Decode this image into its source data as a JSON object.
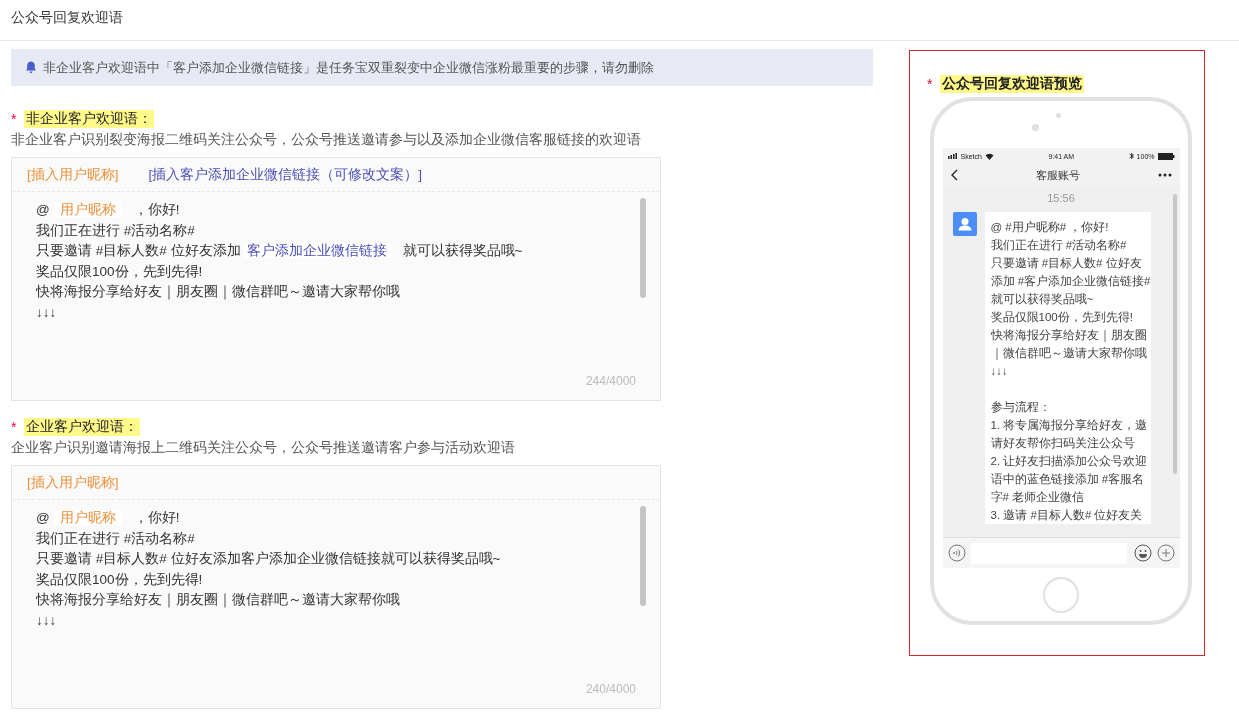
{
  "page_title": "公众号回复欢迎语",
  "notice": {
    "text": "非企业客户欢迎语中「客户添加企业微信链接」是任务宝双重裂变中企业微信涨粉最重要的步骤，请勿删除"
  },
  "sections": [
    {
      "required_mark": "*",
      "label": "非企业客户欢迎语：",
      "description": "非企业客户识别裂变海报二维码关注公众号，公众号推送邀请参与以及添加企业微信客服链接的欢迎语",
      "toolbar": [
        {
          "label": "[插入用户昵称]",
          "kind": "nickname"
        },
        {
          "label": "[插入客户添加企业微信链接（可修改文案）]",
          "kind": "link"
        }
      ],
      "lines": [
        [
          {
            "kind": "text",
            "text": "@"
          },
          {
            "kind": "nickname",
            "text": "用户昵称"
          },
          {
            "kind": "text",
            "text": "，你好!"
          }
        ],
        [
          {
            "kind": "text",
            "text": "我们正在进行 #活动名称#"
          }
        ],
        [
          {
            "kind": "text",
            "text": "只要邀请 #目标人数# 位好友添加"
          },
          {
            "kind": "link",
            "text": "客户添加企业微信链接"
          },
          {
            "kind": "text",
            "text": "就可以获得奖品哦~"
          }
        ],
        [
          {
            "kind": "text",
            "text": "奖品仅限100份，先到先得!"
          }
        ],
        [
          {
            "kind": "text",
            "text": "快将海报分享给好友｜朋友圈｜微信群吧～邀请大家帮你哦"
          }
        ],
        [
          {
            "kind": "text",
            "text": "↓↓↓"
          }
        ]
      ],
      "counter": "244/4000"
    },
    {
      "required_mark": "*",
      "label": "企业客户欢迎语：",
      "description": "企业客户识别邀请海报上二维码关注公众号，公众号推送邀请客户参与活动欢迎语",
      "toolbar": [
        {
          "label": "[插入用户昵称]",
          "kind": "nickname"
        }
      ],
      "lines": [
        [
          {
            "kind": "text",
            "text": "@"
          },
          {
            "kind": "nickname",
            "text": "用户昵称"
          },
          {
            "kind": "text",
            "text": "，你好!"
          }
        ],
        [
          {
            "kind": "text",
            "text": "我们正在进行 #活动名称#"
          }
        ],
        [
          {
            "kind": "text",
            "text": "只要邀请 #目标人数# 位好友添加客户添加企业微信链接就可以获得奖品哦~"
          }
        ],
        [
          {
            "kind": "text",
            "text": "奖品仅限100份，先到先得!"
          }
        ],
        [
          {
            "kind": "text",
            "text": "快将海报分享给好友｜朋友圈｜微信群吧～邀请大家帮你哦"
          }
        ],
        [
          {
            "kind": "text",
            "text": "↓↓↓"
          }
        ]
      ],
      "counter": "240/4000"
    }
  ],
  "preview": {
    "required_mark": "*",
    "title": "公众号回复欢迎语预览",
    "status_bar": {
      "carrier": "Sketch",
      "time": "9:41 AM",
      "battery": "100%"
    },
    "nav_title": "客服账号",
    "timestamp": "15:56",
    "message_paragraphs": [
      [
        "@ #用户昵称#  ，你好!",
        "我们正在进行 #活动名称#",
        "只要邀请 #目标人数# 位好友",
        "添加 #客户添加企业微信链接#",
        " 就可以获得奖品哦~",
        "奖品仅限100份，先到先得!",
        "快将海报分享给好友｜朋友圈",
        "｜微信群吧～邀请大家帮你哦",
        "↓↓↓"
      ],
      [
        "参与流程：",
        "1. 将专属海报分享给好友，邀",
        "请好友帮你扫码关注公众号",
        "2. 让好友扫描添加公众号欢迎",
        "语中的蓝色链接添加 #客服名",
        "字# 老师企业微信",
        "3. 邀请 #目标人数# 位好友关"
      ]
    ]
  }
}
